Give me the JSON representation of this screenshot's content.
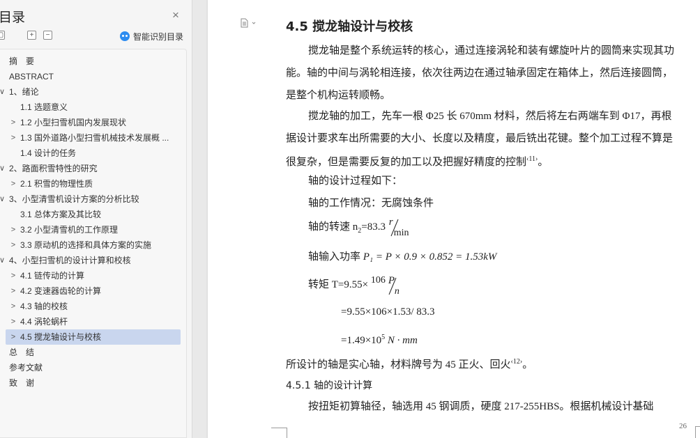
{
  "sidebar": {
    "title": "目录",
    "smart_label": "智能识别目录",
    "toc": [
      {
        "label": "摘　要",
        "level": 0,
        "chevron": ""
      },
      {
        "label": "ABSTRACT",
        "level": 0,
        "chevron": ""
      },
      {
        "label": "1、绪论",
        "level": 0,
        "chevron": "∨"
      },
      {
        "label": "1.1 选题意义",
        "level": 1,
        "chevron": ""
      },
      {
        "label": "1.2 小型扫雪机国内发展现状",
        "level": 1,
        "chevron": ">"
      },
      {
        "label": "1.3 国外道路小型扫雪机械技术发展概 ...",
        "level": 1,
        "chevron": ">"
      },
      {
        "label": "1.4 设计的任务",
        "level": 1,
        "chevron": ""
      },
      {
        "label": "2、路面积雪特性的研究",
        "level": 0,
        "chevron": "∨"
      },
      {
        "label": "2.1 积雪的物理性质",
        "level": 1,
        "chevron": ">"
      },
      {
        "label": "3、小型清雪机设计方案的分析比较",
        "level": 0,
        "chevron": "∨"
      },
      {
        "label": "3.1 总体方案及其比较",
        "level": 1,
        "chevron": ""
      },
      {
        "label": "3.2 小型清雪机的工作原理",
        "level": 1,
        "chevron": ">"
      },
      {
        "label": "3.3 原动机的选择和具体方案的实施",
        "level": 1,
        "chevron": ">"
      },
      {
        "label": "4、小型扫雪机的设计计算和校核",
        "level": 0,
        "chevron": "∨"
      },
      {
        "label": "4.1 链传动的计算",
        "level": 1,
        "chevron": ">"
      },
      {
        "label": "4.2 变速器齿轮的计算",
        "level": 1,
        "chevron": ">"
      },
      {
        "label": "4.3 轴的校核",
        "level": 1,
        "chevron": ">"
      },
      {
        "label": "4.4 涡轮蜗杆",
        "level": 1,
        "chevron": ">"
      },
      {
        "label": "4.5 搅龙轴设计与校核",
        "level": 1,
        "chevron": ">",
        "active": true
      },
      {
        "label": "总　结",
        "level": 0,
        "chevron": ""
      },
      {
        "label": "参考文献",
        "level": 0,
        "chevron": ""
      },
      {
        "label": "致　谢",
        "level": 0,
        "chevron": ""
      }
    ]
  },
  "doc": {
    "heading": "4.5 搅龙轴设计与校核",
    "p1_l1": "搅龙轴是整个系统运转的核心，通过连接涡轮和装有螺旋叶片的圆筒来实现其功",
    "p1_l2": "能。轴的中间与涡轮相连接，依次往两边在通过轴承固定在箱体上，然后连接圆筒，",
    "p1_l3": "是整个机构运转顺畅。",
    "p2_l1": "搅龙轴的加工，先车一根 Φ25 长 670mm 材料，然后将左右两端车到 Φ17，再根",
    "p2_l2": "据设计要求车出所需要的大小、长度以及精度，最后铣出花键。整个加工过程不算是",
    "p2_l3": "很复杂，但是需要反复的加工以及把握好精度的控制",
    "p2_ref": "‹11›",
    "p2_end": "。",
    "l_design": "轴的设计过程如下：",
    "l_work": "轴的工作情况：无腐蚀条件",
    "speed_label": "轴的转速 n",
    "speed_sub": "2",
    "speed_val": "=83.3",
    "speed_num": "r",
    "speed_den": "min",
    "power_label": "轴输入功率",
    "power_formula": "P₁ = P × 0.9 × 0.852 = 1.53kW",
    "torque_label": "转矩 T=9.55×",
    "torque_pow": "106",
    "torque_num": "P",
    "torque_den": "n",
    "eq2": "=9.55×106×1.53/ 83.3",
    "eq3_a": "=1.49×10",
    "eq3_sup": "5",
    "eq3_b": " N · mm",
    "material": "所设计的轴是实心轴，材料牌号为 45 正火、回火",
    "material_ref": "‹12›",
    "material_end": "。",
    "sub_heading": "4.5.1 轴的设计计算",
    "last_line": "按扭矩初算轴径，轴选用 45 钢调质，硬度 217-255HBS。根据机械设计基础",
    "page_number": "26"
  }
}
